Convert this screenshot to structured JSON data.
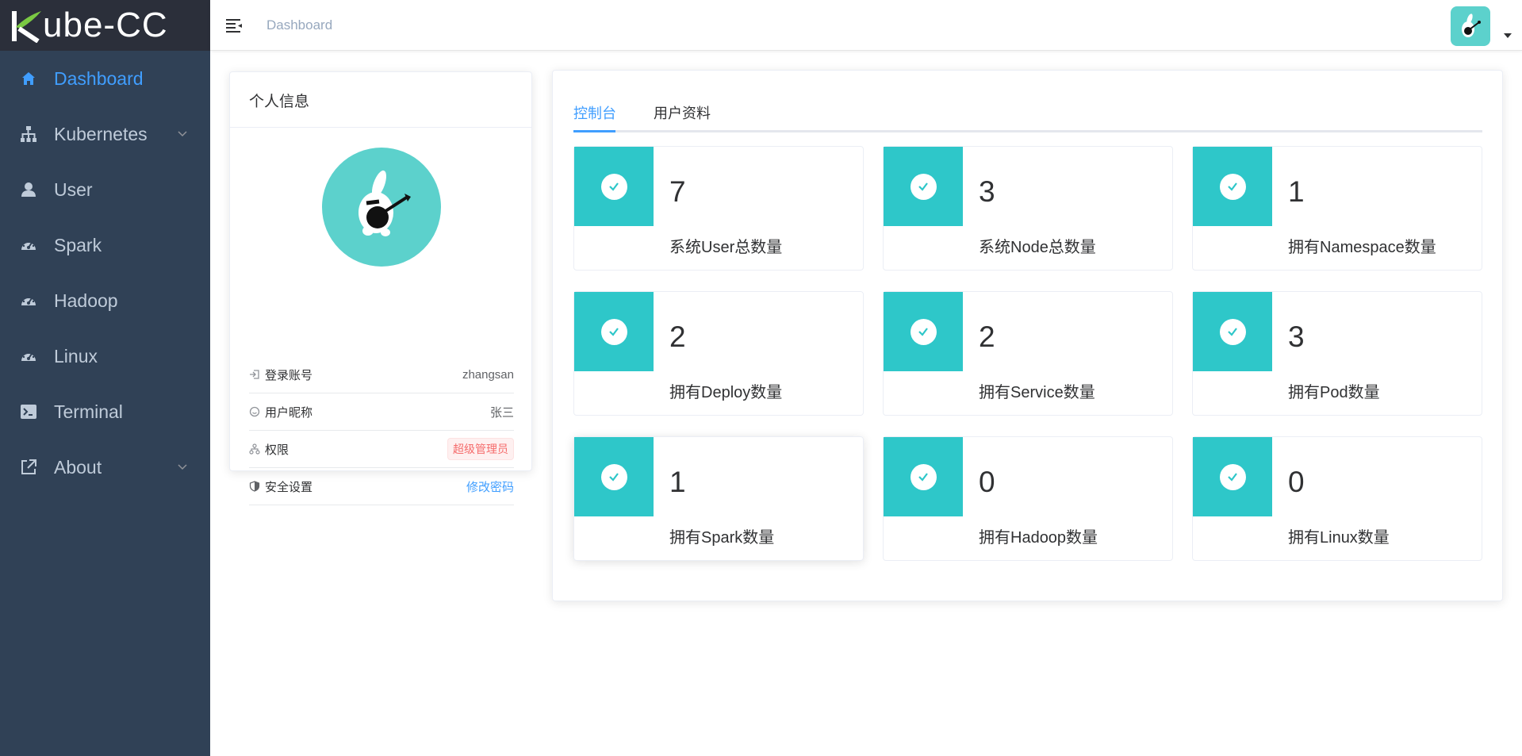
{
  "logo": {
    "text": "ube-CC",
    "letter": "K"
  },
  "sidebar": {
    "items": [
      {
        "label": "Dashboard",
        "icon": "home-icon",
        "active": true
      },
      {
        "label": "Kubernetes",
        "icon": "sitemap-icon",
        "hasChildren": true
      },
      {
        "label": "User",
        "icon": "user-icon"
      },
      {
        "label": "Spark",
        "icon": "gauge-icon"
      },
      {
        "label": "Hadoop",
        "icon": "gauge-icon"
      },
      {
        "label": "Linux",
        "icon": "gauge-icon"
      },
      {
        "label": "Terminal",
        "icon": "terminal-icon"
      },
      {
        "label": "About",
        "icon": "external-link-icon",
        "hasChildren": true
      }
    ]
  },
  "navbar": {
    "breadcrumb": "Dashboard"
  },
  "profile": {
    "title": "个人信息",
    "rows": [
      {
        "label": "登录账号",
        "value": "zhangsan",
        "icon": "login-icon"
      },
      {
        "label": "用户昵称",
        "value": "张三",
        "icon": "smile-icon"
      },
      {
        "label": "权限",
        "value": "超级管理员",
        "icon": "org-icon"
      },
      {
        "label": "安全设置",
        "value": "修改密码",
        "icon": "shield-icon"
      }
    ]
  },
  "tabs": [
    {
      "label": "控制台",
      "active": true
    },
    {
      "label": "用户资料"
    }
  ],
  "stats": [
    {
      "value": "7",
      "label": "系统User总数量"
    },
    {
      "value": "3",
      "label": "系统Node总数量"
    },
    {
      "value": "1",
      "label": "拥有Namespace数量"
    },
    {
      "value": "2",
      "label": "拥有Deploy数量"
    },
    {
      "value": "2",
      "label": "拥有Service数量"
    },
    {
      "value": "3",
      "label": "拥有Pod数量"
    },
    {
      "value": "1",
      "label": "拥有Spark数量"
    },
    {
      "value": "0",
      "label": "拥有Hadoop数量"
    },
    {
      "value": "0",
      "label": "拥有Linux数量"
    }
  ],
  "colors": {
    "sidebar_bg": "#304156",
    "logo_bg": "#2b2f3a",
    "accent": "#409eff",
    "stat_icon_bg": "#2ec7c9",
    "avatar_bg": "#5cd1cc",
    "danger": "#f56c6c"
  }
}
